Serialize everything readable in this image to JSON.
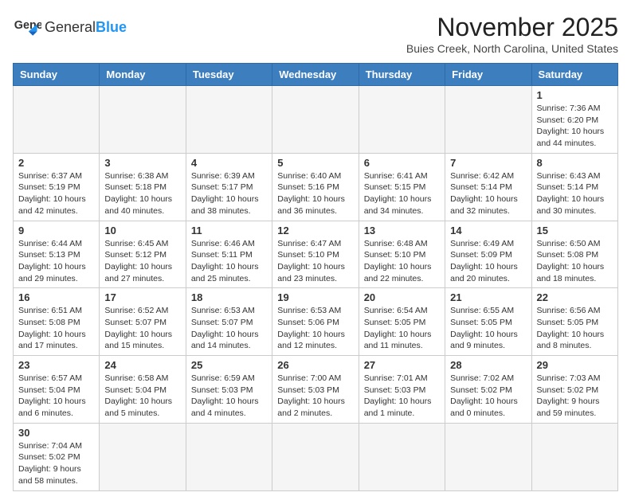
{
  "logo": {
    "text_normal": "General",
    "text_bold": "Blue"
  },
  "header": {
    "title": "November 2025",
    "subtitle": "Buies Creek, North Carolina, United States"
  },
  "days_of_week": [
    "Sunday",
    "Monday",
    "Tuesday",
    "Wednesday",
    "Thursday",
    "Friday",
    "Saturday"
  ],
  "weeks": [
    [
      {
        "day": "",
        "info": ""
      },
      {
        "day": "",
        "info": ""
      },
      {
        "day": "",
        "info": ""
      },
      {
        "day": "",
        "info": ""
      },
      {
        "day": "",
        "info": ""
      },
      {
        "day": "",
        "info": ""
      },
      {
        "day": "1",
        "info": "Sunrise: 7:36 AM\nSunset: 6:20 PM\nDaylight: 10 hours and 44 minutes."
      }
    ],
    [
      {
        "day": "2",
        "info": "Sunrise: 6:37 AM\nSunset: 5:19 PM\nDaylight: 10 hours and 42 minutes."
      },
      {
        "day": "3",
        "info": "Sunrise: 6:38 AM\nSunset: 5:18 PM\nDaylight: 10 hours and 40 minutes."
      },
      {
        "day": "4",
        "info": "Sunrise: 6:39 AM\nSunset: 5:17 PM\nDaylight: 10 hours and 38 minutes."
      },
      {
        "day": "5",
        "info": "Sunrise: 6:40 AM\nSunset: 5:16 PM\nDaylight: 10 hours and 36 minutes."
      },
      {
        "day": "6",
        "info": "Sunrise: 6:41 AM\nSunset: 5:15 PM\nDaylight: 10 hours and 34 minutes."
      },
      {
        "day": "7",
        "info": "Sunrise: 6:42 AM\nSunset: 5:14 PM\nDaylight: 10 hours and 32 minutes."
      },
      {
        "day": "8",
        "info": "Sunrise: 6:43 AM\nSunset: 5:14 PM\nDaylight: 10 hours and 30 minutes."
      }
    ],
    [
      {
        "day": "9",
        "info": "Sunrise: 6:44 AM\nSunset: 5:13 PM\nDaylight: 10 hours and 29 minutes."
      },
      {
        "day": "10",
        "info": "Sunrise: 6:45 AM\nSunset: 5:12 PM\nDaylight: 10 hours and 27 minutes."
      },
      {
        "day": "11",
        "info": "Sunrise: 6:46 AM\nSunset: 5:11 PM\nDaylight: 10 hours and 25 minutes."
      },
      {
        "day": "12",
        "info": "Sunrise: 6:47 AM\nSunset: 5:10 PM\nDaylight: 10 hours and 23 minutes."
      },
      {
        "day": "13",
        "info": "Sunrise: 6:48 AM\nSunset: 5:10 PM\nDaylight: 10 hours and 22 minutes."
      },
      {
        "day": "14",
        "info": "Sunrise: 6:49 AM\nSunset: 5:09 PM\nDaylight: 10 hours and 20 minutes."
      },
      {
        "day": "15",
        "info": "Sunrise: 6:50 AM\nSunset: 5:08 PM\nDaylight: 10 hours and 18 minutes."
      }
    ],
    [
      {
        "day": "16",
        "info": "Sunrise: 6:51 AM\nSunset: 5:08 PM\nDaylight: 10 hours and 17 minutes."
      },
      {
        "day": "17",
        "info": "Sunrise: 6:52 AM\nSunset: 5:07 PM\nDaylight: 10 hours and 15 minutes."
      },
      {
        "day": "18",
        "info": "Sunrise: 6:53 AM\nSunset: 5:07 PM\nDaylight: 10 hours and 14 minutes."
      },
      {
        "day": "19",
        "info": "Sunrise: 6:53 AM\nSunset: 5:06 PM\nDaylight: 10 hours and 12 minutes."
      },
      {
        "day": "20",
        "info": "Sunrise: 6:54 AM\nSunset: 5:05 PM\nDaylight: 10 hours and 11 minutes."
      },
      {
        "day": "21",
        "info": "Sunrise: 6:55 AM\nSunset: 5:05 PM\nDaylight: 10 hours and 9 minutes."
      },
      {
        "day": "22",
        "info": "Sunrise: 6:56 AM\nSunset: 5:05 PM\nDaylight: 10 hours and 8 minutes."
      }
    ],
    [
      {
        "day": "23",
        "info": "Sunrise: 6:57 AM\nSunset: 5:04 PM\nDaylight: 10 hours and 6 minutes."
      },
      {
        "day": "24",
        "info": "Sunrise: 6:58 AM\nSunset: 5:04 PM\nDaylight: 10 hours and 5 minutes."
      },
      {
        "day": "25",
        "info": "Sunrise: 6:59 AM\nSunset: 5:03 PM\nDaylight: 10 hours and 4 minutes."
      },
      {
        "day": "26",
        "info": "Sunrise: 7:00 AM\nSunset: 5:03 PM\nDaylight: 10 hours and 2 minutes."
      },
      {
        "day": "27",
        "info": "Sunrise: 7:01 AM\nSunset: 5:03 PM\nDaylight: 10 hours and 1 minute."
      },
      {
        "day": "28",
        "info": "Sunrise: 7:02 AM\nSunset: 5:02 PM\nDaylight: 10 hours and 0 minutes."
      },
      {
        "day": "29",
        "info": "Sunrise: 7:03 AM\nSunset: 5:02 PM\nDaylight: 9 hours and 59 minutes."
      }
    ],
    [
      {
        "day": "30",
        "info": "Sunrise: 7:04 AM\nSunset: 5:02 PM\nDaylight: 9 hours and 58 minutes."
      },
      {
        "day": "",
        "info": ""
      },
      {
        "day": "",
        "info": ""
      },
      {
        "day": "",
        "info": ""
      },
      {
        "day": "",
        "info": ""
      },
      {
        "day": "",
        "info": ""
      },
      {
        "day": "",
        "info": ""
      }
    ]
  ]
}
